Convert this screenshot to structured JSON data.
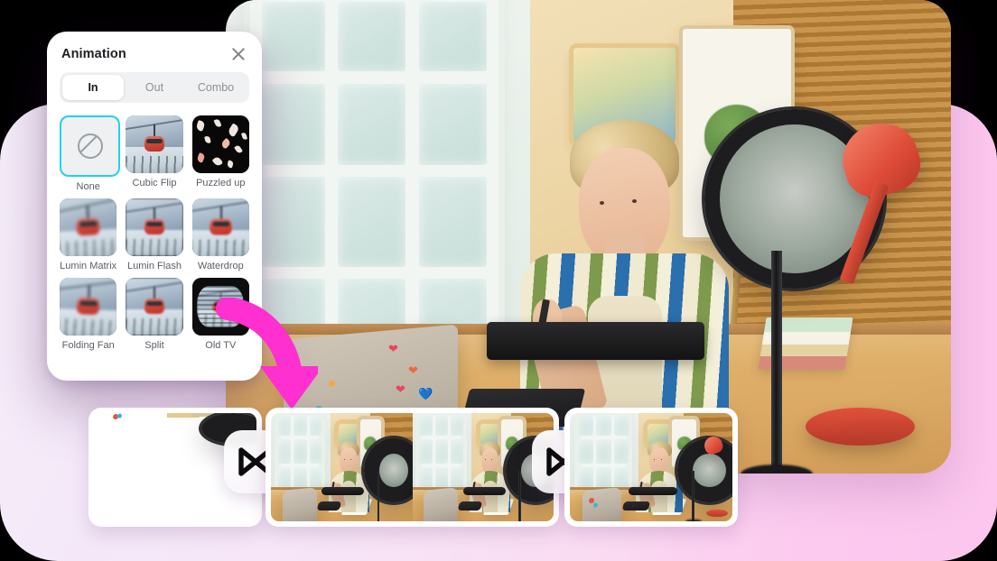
{
  "panel": {
    "title": "Animation",
    "close_icon": "close-icon",
    "tabs": [
      {
        "label": "In",
        "active": true
      },
      {
        "label": "Out",
        "active": false
      },
      {
        "label": "Combo",
        "active": false
      }
    ],
    "selected_item": "None",
    "accent_selected_color": "#22cff0",
    "items": [
      {
        "label": "None",
        "thumb": "none-icon"
      },
      {
        "label": "Cubic Flip",
        "thumb": "gondola-preview"
      },
      {
        "label": "Puzzled up",
        "thumb": "puzzle-shards-preview"
      },
      {
        "label": "Lumin Matrix",
        "thumb": "gondola-preview"
      },
      {
        "label": "Lumin Flash",
        "thumb": "gondola-preview"
      },
      {
        "label": "Waterdrop",
        "thumb": "gondola-preview"
      },
      {
        "label": "Folding Fan",
        "thumb": "gondola-preview"
      },
      {
        "label": "Split",
        "thumb": "gondola-preview"
      },
      {
        "label": "Old TV",
        "thumb": "old-tv-preview"
      }
    ]
  },
  "callout": {
    "arrow_icon": "curved-down-arrow-icon",
    "arrow_color": "#FF2FD0"
  },
  "preview": {
    "scene_description": "Creator in striped shirt at studio desk with laptop, ring light and red lamp"
  },
  "timeline": {
    "clips": [
      {
        "name": "clip-1"
      },
      {
        "name": "clip-2"
      },
      {
        "name": "clip-3"
      },
      {
        "name": "clip-4"
      }
    ],
    "transitions": [
      {
        "name": "transition-1",
        "icon": "transition-bowtie-icon"
      },
      {
        "name": "transition-2",
        "icon": "transition-bowtie-icon"
      }
    ]
  },
  "theme": {
    "backdrop_left": "#f6eefa",
    "backdrop_right": "#fcc6ee",
    "panel_bg": "#ffffff"
  },
  "floaties": [
    "❤",
    "❤",
    "💙",
    "❤"
  ]
}
